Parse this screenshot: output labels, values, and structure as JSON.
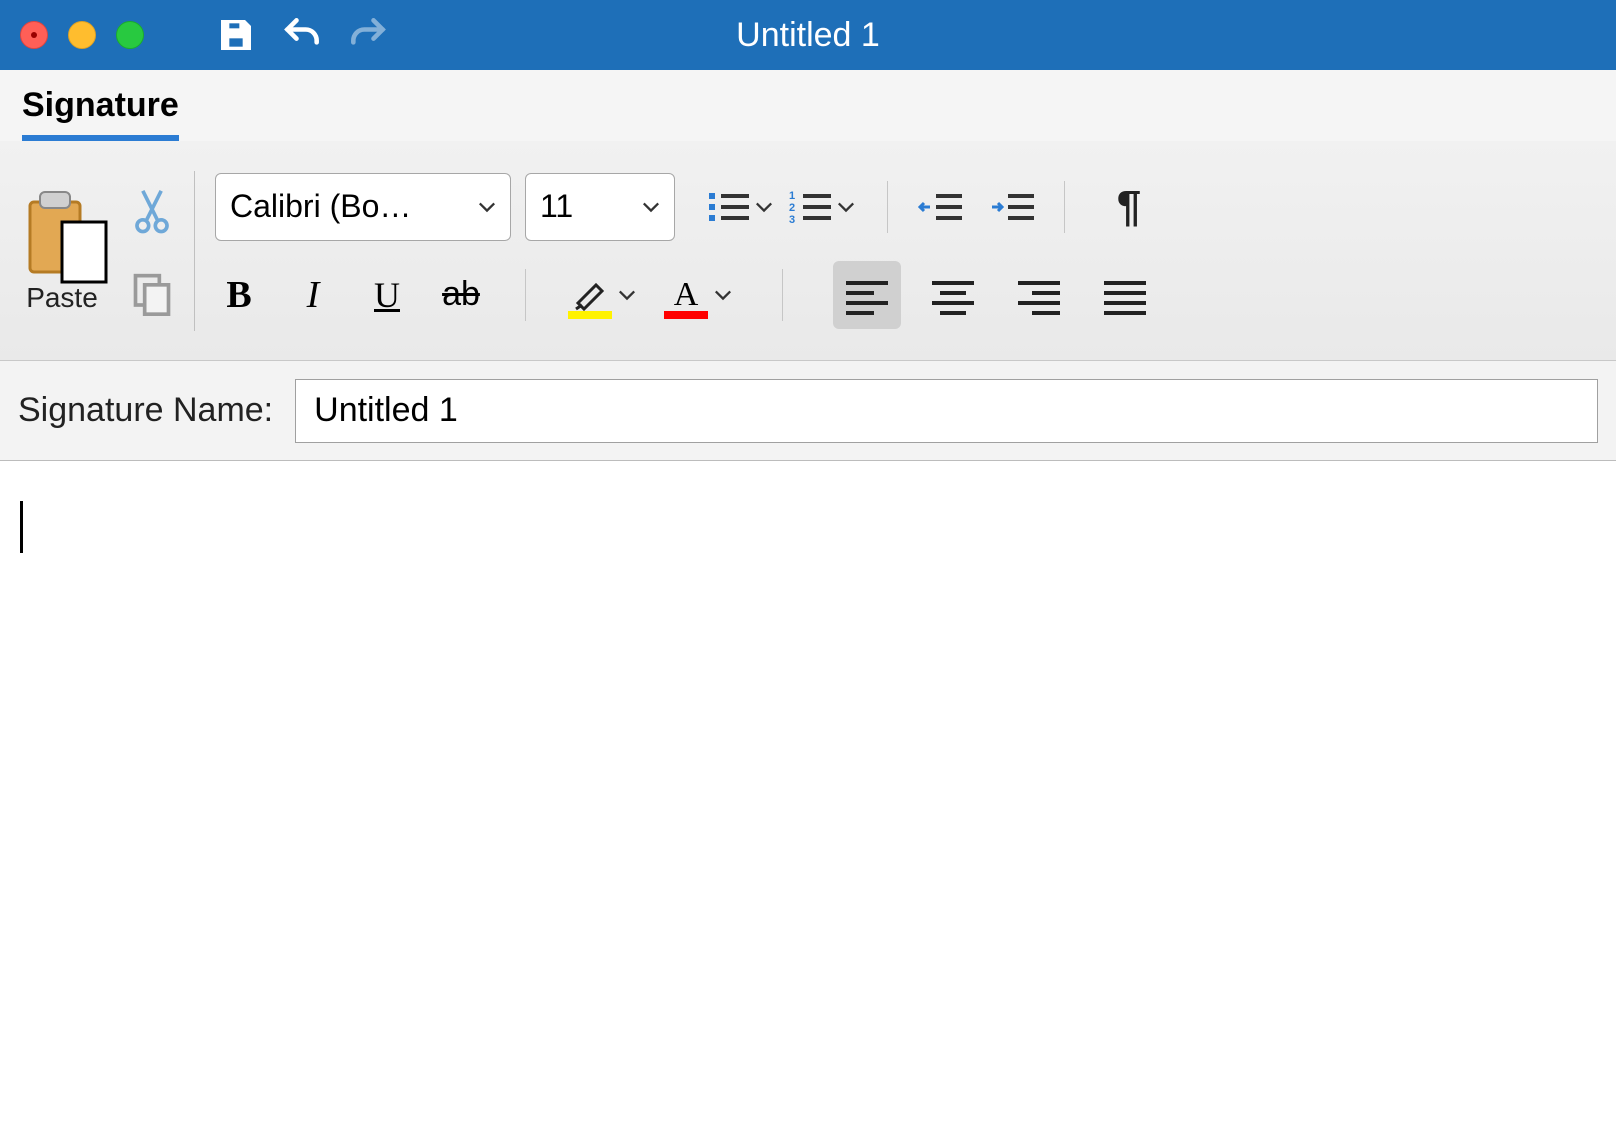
{
  "window": {
    "title": "Untitled 1"
  },
  "ribbonTab": {
    "label": "Signature"
  },
  "clipboard": {
    "paste_label": "Paste"
  },
  "font": {
    "name": "Calibri (Bo…",
    "size": "11"
  },
  "colors": {
    "highlight": "#fff200",
    "fontcolor": "#ff0000"
  },
  "signature": {
    "label": "Signature Name:",
    "value": "Untitled 1"
  }
}
